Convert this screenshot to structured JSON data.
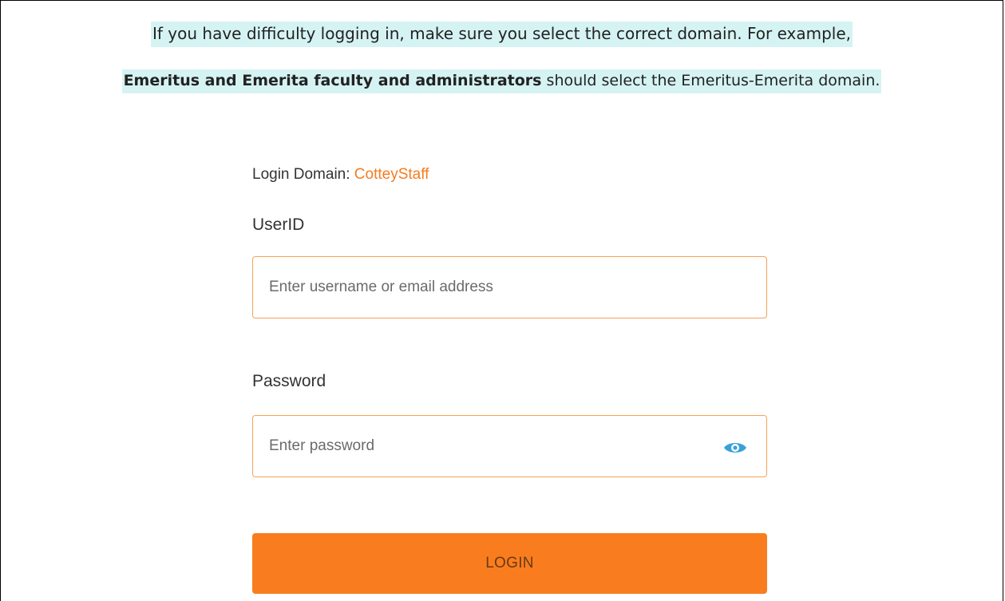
{
  "notice": {
    "line1": "If you have difficulty logging in, make sure you select the correct domain.  For example,",
    "line2_bold": "Emeritus and Emerita faculty and administrators",
    "line2_rest": " should select the Emeritus-Emerita domain."
  },
  "login": {
    "domain_label": "Login Domain: ",
    "domain_value": "CotteyStaff",
    "userid_label": "UserID",
    "userid_placeholder": "Enter username or email address",
    "password_label": "Password",
    "password_placeholder": "Enter password",
    "password_toggle_icon": "eye-icon",
    "submit_label": "LOGIN"
  },
  "colors": {
    "accent": "#f97d1e",
    "input_border": "#f5a25a",
    "domain_text": "#f47c20",
    "highlight": "#d6f3f3",
    "eye_icon": "#3aa0dc"
  }
}
